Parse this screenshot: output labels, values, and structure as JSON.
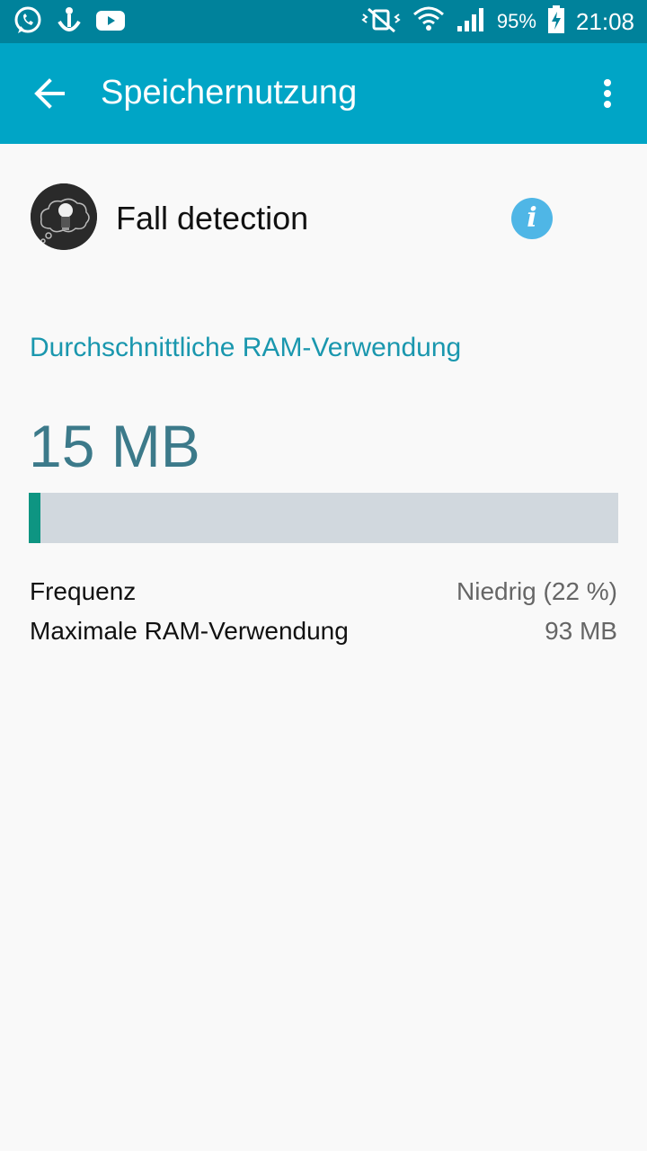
{
  "status_bar": {
    "notification_icons": [
      "whatsapp-icon",
      "upload-icon",
      "youtube-icon"
    ],
    "system_icons": [
      "vibrate-mute-icon",
      "wifi-icon",
      "signal-icon"
    ],
    "battery_percent": "95%",
    "time": "21:08"
  },
  "app_bar": {
    "title": "Speichernutzung",
    "back_icon": "arrow-back-icon",
    "more_icon": "more-vert-icon"
  },
  "app_info": {
    "name": "Fall detection",
    "info_glyph": "i"
  },
  "ram": {
    "section_title": "Durchschnittliche RAM-Verwendung",
    "average_value": "15 MB",
    "bar_fraction": 0.02
  },
  "stats": [
    {
      "label": "Frequenz",
      "value": "Niedrig (22 %)"
    },
    {
      "label": "Maximale RAM-Verwendung",
      "value": "93 MB"
    }
  ],
  "colors": {
    "status_bar": "#00829b",
    "app_bar": "#00a5c6",
    "accent_text": "#1a97ae",
    "value_text": "#3c7a8a",
    "bar_fill": "#0e9582",
    "bar_track": "#d1d8de",
    "info_button": "#4fb6e6"
  }
}
